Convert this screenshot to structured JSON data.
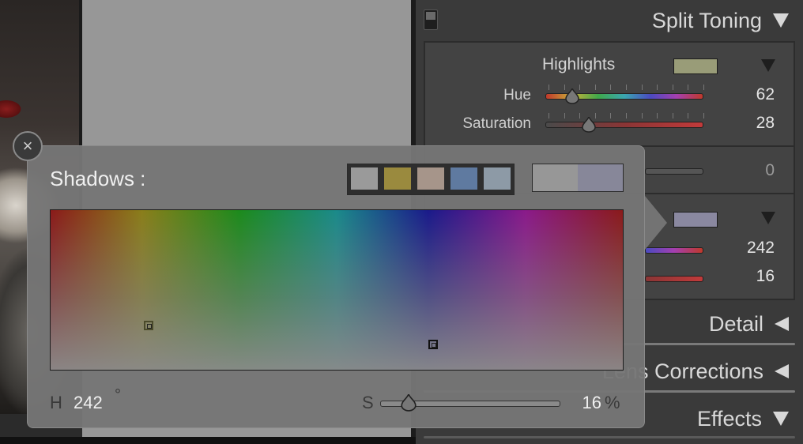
{
  "panel": {
    "section_title": "Split Toning",
    "highlights": {
      "label": "Highlights",
      "swatch_color": "#999c78",
      "hue_label": "Hue",
      "hue_value": "62",
      "hue_fraction": 0.17,
      "saturation_label": "Saturation",
      "saturation_value": "28",
      "saturation_fraction": 0.28
    },
    "balance_value": "0",
    "shadows": {
      "swatch_color": "#8a88a0",
      "hue_value": "242",
      "saturation_value": "16"
    },
    "sections": [
      {
        "label": "Detail",
        "state": "collapsed"
      },
      {
        "label": "Lens Corrections",
        "state": "collapsed"
      },
      {
        "label": "Effects",
        "state": "expanded"
      }
    ]
  },
  "popup": {
    "title": "Shadows :",
    "close_glyph": "×",
    "presets": [
      "#9a9a9a",
      "#9a8a3e",
      "#a6958a",
      "#5f7aa0",
      "#8d9aa6"
    ],
    "compare": {
      "before": "#979797",
      "after": "#878799"
    },
    "h_label": "H",
    "h_value": "242",
    "degree": "°",
    "s_label": "S",
    "s_value": "16",
    "percent": "%",
    "saturation_fraction": 0.16
  }
}
